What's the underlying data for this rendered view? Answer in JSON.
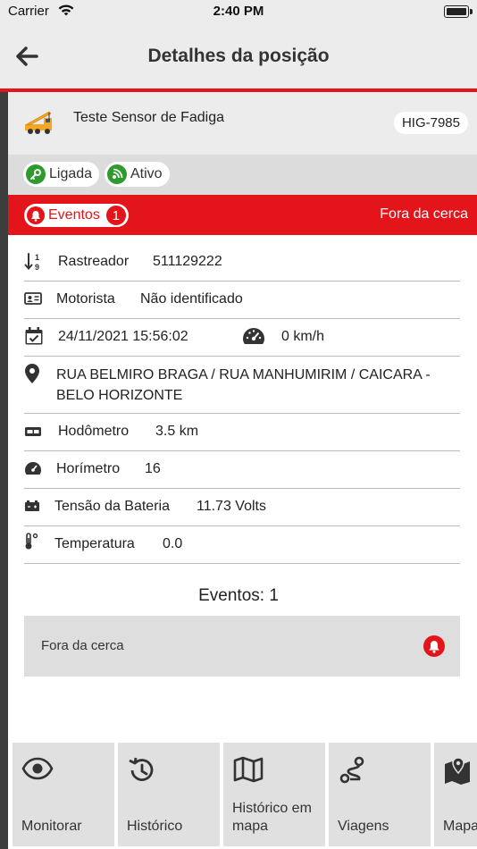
{
  "status_bar": {
    "carrier": "Carrier",
    "time": "2:40 PM"
  },
  "header": {
    "title": "Detalhes da posição"
  },
  "vehicle": {
    "name": "Teste Sensor de Fadiga",
    "plate": "HIG-7985"
  },
  "status_chips": [
    {
      "label": "Ligada",
      "icon": "key-icon",
      "color": "#2e9b2e"
    },
    {
      "label": "Ativo",
      "icon": "signal-icon",
      "color": "#2e9b2e"
    }
  ],
  "events_bar": {
    "label": "Eventos",
    "count": "1",
    "status": "Fora da cerca",
    "color": "#e4141b"
  },
  "details": {
    "tracker_label": "Rastreador",
    "tracker_value": "511129222",
    "driver_label": "Motorista",
    "driver_value": "Não identificado",
    "datetime": "24/11/2021 15:56:02",
    "speed": "0 km/h",
    "address": "RUA BELMIRO BRAGA / RUA MANHUMIRIM / CAICARA - BELO HORIZONTE",
    "odometer_label": "Hodômetro",
    "odometer_value": "3.5 km",
    "hourmeter_label": "Horímetro",
    "hourmeter_value": "16",
    "battery_label": "Tensão da Bateria",
    "battery_value": "11.73 Volts",
    "temperature_label": "Temperatura",
    "temperature_value": "0.0"
  },
  "events_section": {
    "title": "Eventos: 1",
    "items": [
      {
        "label": "Fora da cerca",
        "icon": "bell-icon"
      }
    ]
  },
  "actions": [
    {
      "label": "Monitorar",
      "icon": "eye-icon"
    },
    {
      "label": "Histórico",
      "icon": "history-icon"
    },
    {
      "label": "Histórico em mapa",
      "icon": "map-icon"
    },
    {
      "label": "Viagens",
      "icon": "route-icon"
    },
    {
      "label": "Mapa externo",
      "icon": "map-pin-icon"
    }
  ]
}
